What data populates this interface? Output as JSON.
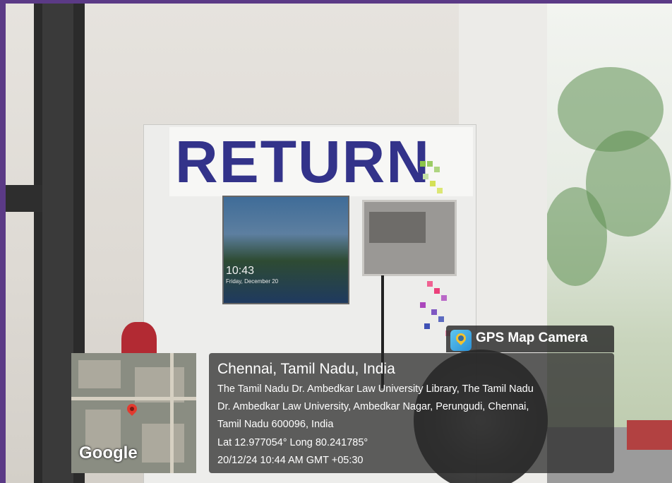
{
  "kiosk": {
    "sign": "RETURN",
    "screen_time": "10:43",
    "screen_date": "Friday, December 20"
  },
  "overlay": {
    "app_name": "GPS Map Camera",
    "location_title": "Chennai, Tamil Nadu, India",
    "address_lines": [
      "The Tamil Nadu Dr. Ambedkar Law University Library, The Tamil Nadu",
      "Dr. Ambedkar Law University, Ambedkar Nagar, Perungudi, Chennai,",
      "Tamil Nadu 600096, India"
    ],
    "coordinates": "Lat 12.977054° Long 80.241785°",
    "timestamp": "20/12/24 10:44 AM GMT +05:30",
    "map_brand": "Google"
  },
  "colors": {
    "sign_text": "#33338a",
    "overlay_bg": "#282828",
    "map_pin": "#e23a2f"
  }
}
